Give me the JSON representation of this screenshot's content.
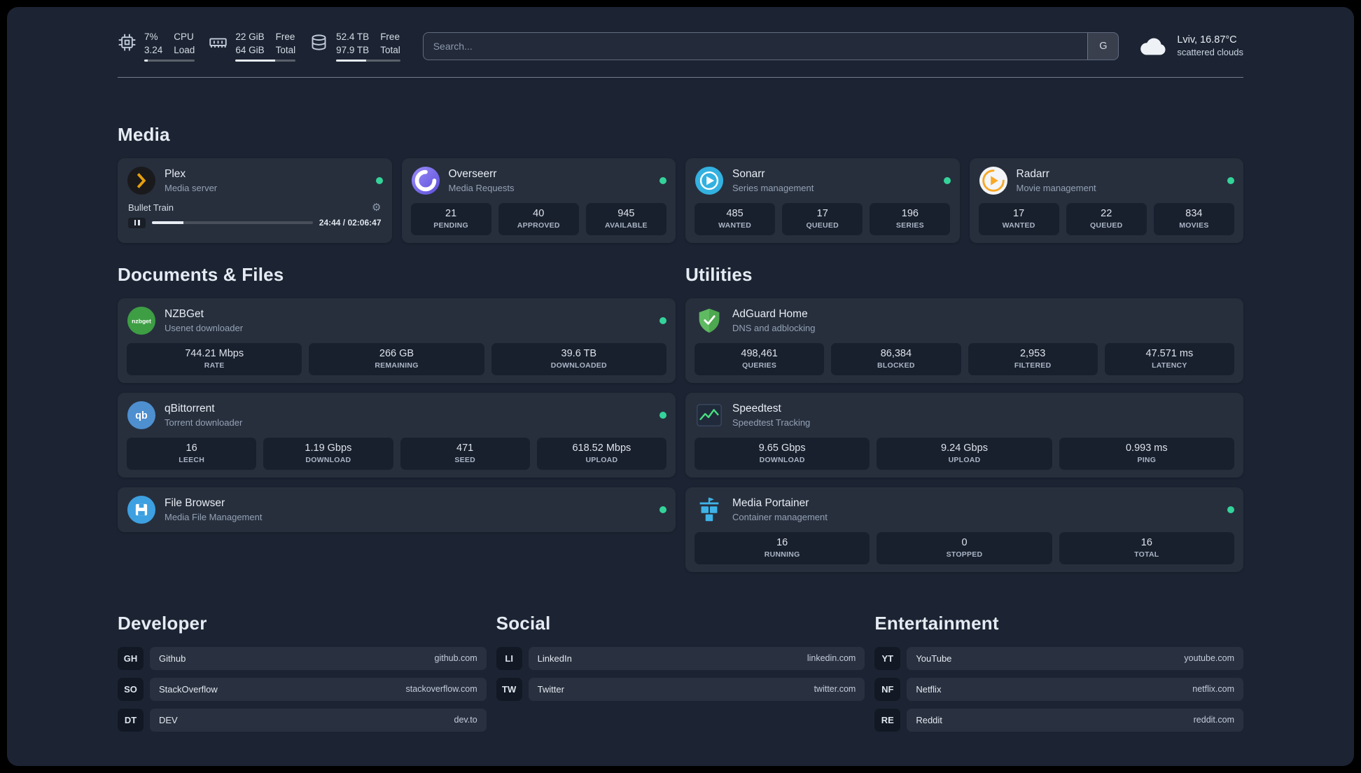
{
  "system": {
    "cpu": {
      "percent": "7%",
      "percent_label": "CPU",
      "load": "3.24",
      "load_label": "Load",
      "bar_percent": 7
    },
    "memory": {
      "free": "22 GiB",
      "free_label": "Free",
      "total": "64 GiB",
      "total_label": "Total",
      "bar_percent": 66
    },
    "disk": {
      "free": "52.4 TB",
      "free_label": "Free",
      "total": "97.9 TB",
      "total_label": "Total",
      "bar_percent": 47
    }
  },
  "search": {
    "placeholder": "Search...",
    "provider_button": "G"
  },
  "weather": {
    "location": "Lviv, 16.87°C",
    "condition": "scattered clouds"
  },
  "media": {
    "title": "Media",
    "plex": {
      "name": "Plex",
      "desc": "Media server",
      "now_playing": "Bullet Train",
      "time": "24:44 / 02:06:47",
      "progress_percent": 19.5
    },
    "overseerr": {
      "name": "Overseerr",
      "desc": "Media Requests",
      "stats": [
        {
          "value": "21",
          "label": "PENDING"
        },
        {
          "value": "40",
          "label": "APPROVED"
        },
        {
          "value": "945",
          "label": "AVAILABLE"
        }
      ]
    },
    "sonarr": {
      "name": "Sonarr",
      "desc": "Series management",
      "stats": [
        {
          "value": "485",
          "label": "WANTED"
        },
        {
          "value": "17",
          "label": "QUEUED"
        },
        {
          "value": "196",
          "label": "SERIES"
        }
      ]
    },
    "radarr": {
      "name": "Radarr",
      "desc": "Movie management",
      "stats": [
        {
          "value": "17",
          "label": "WANTED"
        },
        {
          "value": "22",
          "label": "QUEUED"
        },
        {
          "value": "834",
          "label": "MOVIES"
        }
      ]
    }
  },
  "documents": {
    "title": "Documents & Files",
    "nzbget": {
      "name": "NZBGet",
      "desc": "Usenet downloader",
      "stats": [
        {
          "value": "744.21 Mbps",
          "label": "RATE"
        },
        {
          "value": "266 GB",
          "label": "REMAINING"
        },
        {
          "value": "39.6 TB",
          "label": "DOWNLOADED"
        }
      ]
    },
    "qbittorrent": {
      "name": "qBittorrent",
      "desc": "Torrent downloader",
      "stats": [
        {
          "value": "16",
          "label": "LEECH"
        },
        {
          "value": "1.19 Gbps",
          "label": "DOWNLOAD"
        },
        {
          "value": "471",
          "label": "SEED"
        },
        {
          "value": "618.52 Mbps",
          "label": "UPLOAD"
        }
      ]
    },
    "filebrowser": {
      "name": "File Browser",
      "desc": "Media File Management"
    }
  },
  "utilities": {
    "title": "Utilities",
    "adguard": {
      "name": "AdGuard Home",
      "desc": "DNS and adblocking",
      "stats": [
        {
          "value": "498,461",
          "label": "QUERIES"
        },
        {
          "value": "86,384",
          "label": "BLOCKED"
        },
        {
          "value": "2,953",
          "label": "FILTERED"
        },
        {
          "value": "47.571 ms",
          "label": "LATENCY"
        }
      ]
    },
    "speedtest": {
      "name": "Speedtest",
      "desc": "Speedtest Tracking",
      "stats": [
        {
          "value": "9.65 Gbps",
          "label": "DOWNLOAD"
        },
        {
          "value": "9.24 Gbps",
          "label": "UPLOAD"
        },
        {
          "value": "0.993 ms",
          "label": "PING"
        }
      ]
    },
    "portainer": {
      "name": "Media Portainer",
      "desc": "Container management",
      "stats": [
        {
          "value": "16",
          "label": "RUNNING"
        },
        {
          "value": "0",
          "label": "STOPPED"
        },
        {
          "value": "16",
          "label": "TOTAL"
        }
      ]
    }
  },
  "bookmarks": {
    "developer": {
      "title": "Developer",
      "items": [
        {
          "abbr": "GH",
          "name": "Github",
          "url": "github.com"
        },
        {
          "abbr": "SO",
          "name": "StackOverflow",
          "url": "stackoverflow.com"
        },
        {
          "abbr": "DT",
          "name": "DEV",
          "url": "dev.to"
        }
      ]
    },
    "social": {
      "title": "Social",
      "items": [
        {
          "abbr": "LI",
          "name": "LinkedIn",
          "url": "linkedin.com"
        },
        {
          "abbr": "TW",
          "name": "Twitter",
          "url": "twitter.com"
        }
      ]
    },
    "entertainment": {
      "title": "Entertainment",
      "items": [
        {
          "abbr": "YT",
          "name": "YouTube",
          "url": "youtube.com"
        },
        {
          "abbr": "NF",
          "name": "Netflix",
          "url": "netflix.com"
        },
        {
          "abbr": "RE",
          "name": "Reddit",
          "url": "reddit.com"
        }
      ]
    }
  },
  "colors": {
    "page_bg": "#1c2433",
    "status_online": "#34d399",
    "plex_accent": "#e5a00d",
    "adguard_green": "#5fba61",
    "speedtest_line": "#49de80",
    "portainer_blue": "#3fb3e8"
  },
  "icons": {
    "gear-icon": "⚙"
  }
}
